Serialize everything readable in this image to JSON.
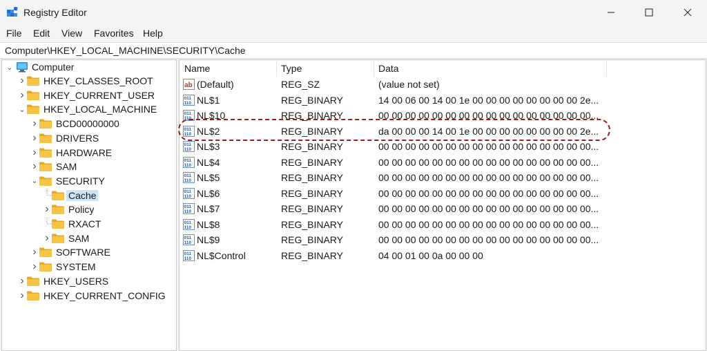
{
  "window": {
    "title": "Registry Editor",
    "app_icon": "regedit-icon"
  },
  "menu": [
    "File",
    "Edit",
    "View",
    "Favorites",
    "Help"
  ],
  "address": "Computer\\HKEY_LOCAL_MACHINE\\SECURITY\\Cache",
  "tree": {
    "root": "Computer",
    "items": [
      {
        "label": "HKEY_CLASSES_ROOT"
      },
      {
        "label": "HKEY_CURRENT_USER"
      },
      {
        "label": "HKEY_LOCAL_MACHINE"
      },
      {
        "label": "BCD00000000"
      },
      {
        "label": "DRIVERS"
      },
      {
        "label": "HARDWARE"
      },
      {
        "label": "SAM"
      },
      {
        "label": "SECURITY"
      },
      {
        "label": "Cache"
      },
      {
        "label": "Policy"
      },
      {
        "label": "RXACT"
      },
      {
        "label": "SAM"
      },
      {
        "label": "SOFTWARE"
      },
      {
        "label": "SYSTEM"
      },
      {
        "label": "HKEY_USERS"
      },
      {
        "label": "HKEY_CURRENT_CONFIG"
      }
    ]
  },
  "columns": {
    "name": "Name",
    "type": "Type",
    "data": "Data"
  },
  "rows": [
    {
      "name": "(Default)",
      "type": "REG_SZ",
      "data": "(value not set)",
      "icon": "string-value-icon"
    },
    {
      "name": "NL$1",
      "type": "REG_BINARY",
      "data": "14 00 06 00 14 00 1e 00 00 00 00 00 00 00 00 2e...",
      "icon": "binary-value-icon"
    },
    {
      "name": "NL$10",
      "type": "REG_BINARY",
      "data": "00 00 00 00 00 00 00 00 00 00 00 00 00 00 00 00...",
      "icon": "binary-value-icon"
    },
    {
      "name": "NL$2",
      "type": "REG_BINARY",
      "data": "da 00 00 00 14 00 1e 00 00 00 00 00 00 00 00 2e...",
      "icon": "binary-value-icon"
    },
    {
      "name": "NL$3",
      "type": "REG_BINARY",
      "data": "00 00 00 00 00 00 00 00 00 00 00 00 00 00 00 00...",
      "icon": "binary-value-icon"
    },
    {
      "name": "NL$4",
      "type": "REG_BINARY",
      "data": "00 00 00 00 00 00 00 00 00 00 00 00 00 00 00 00...",
      "icon": "binary-value-icon"
    },
    {
      "name": "NL$5",
      "type": "REG_BINARY",
      "data": "00 00 00 00 00 00 00 00 00 00 00 00 00 00 00 00...",
      "icon": "binary-value-icon"
    },
    {
      "name": "NL$6",
      "type": "REG_BINARY",
      "data": "00 00 00 00 00 00 00 00 00 00 00 00 00 00 00 00...",
      "icon": "binary-value-icon"
    },
    {
      "name": "NL$7",
      "type": "REG_BINARY",
      "data": "00 00 00 00 00 00 00 00 00 00 00 00 00 00 00 00...",
      "icon": "binary-value-icon"
    },
    {
      "name": "NL$8",
      "type": "REG_BINARY",
      "data": "00 00 00 00 00 00 00 00 00 00 00 00 00 00 00 00...",
      "icon": "binary-value-icon"
    },
    {
      "name": "NL$9",
      "type": "REG_BINARY",
      "data": "00 00 00 00 00 00 00 00 00 00 00 00 00 00 00 00...",
      "icon": "binary-value-icon"
    },
    {
      "name": "NL$Control",
      "type": "REG_BINARY",
      "data": "04 00 01 00 0a 00 00 00",
      "icon": "binary-value-icon"
    }
  ],
  "colors": {
    "accent_highlight": "#9e1b1b",
    "selection": "#cce4f7",
    "folder": "#f6c445"
  }
}
